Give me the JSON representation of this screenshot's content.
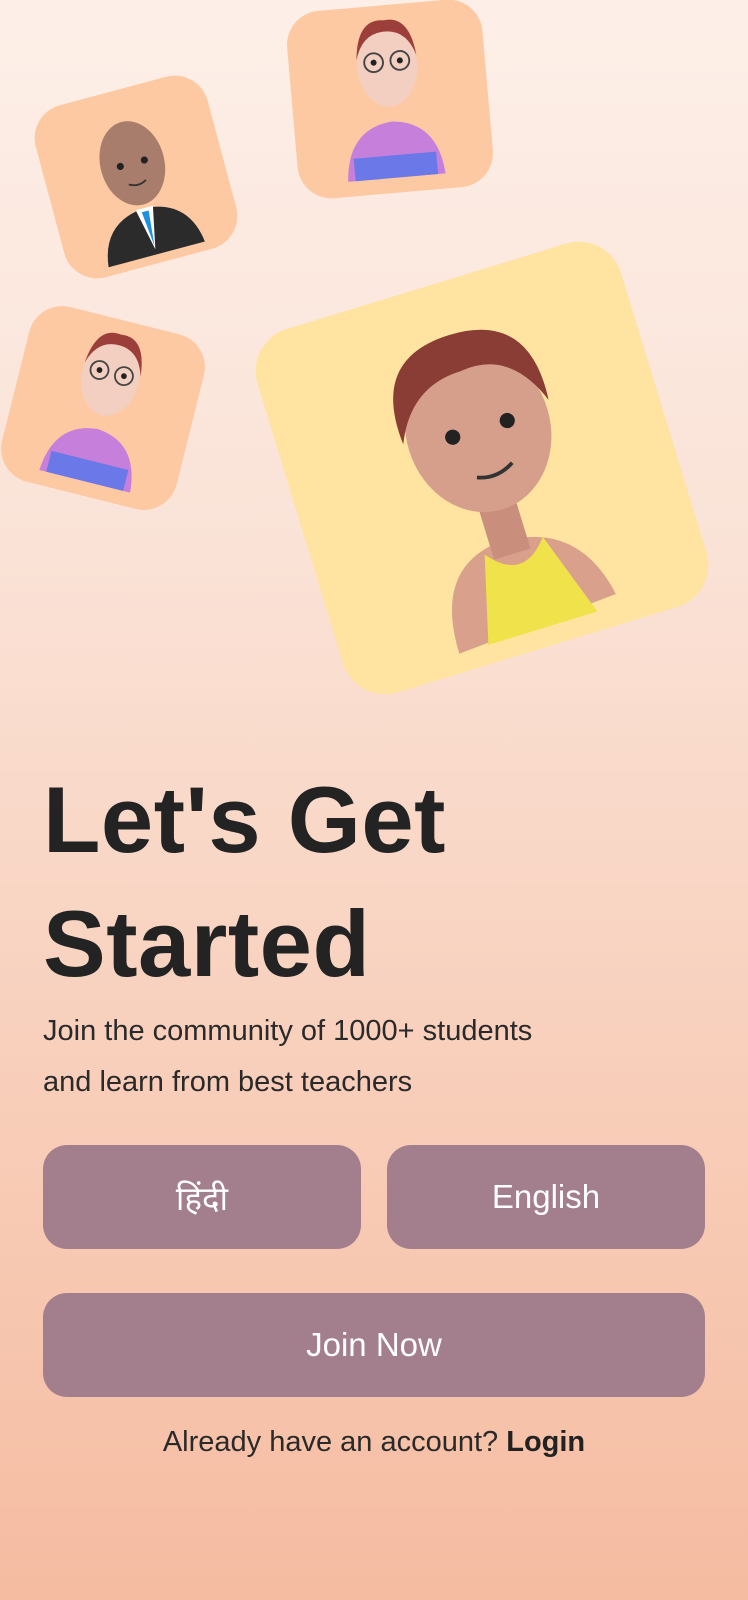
{
  "hero": {
    "title_line1": "Let's Get",
    "title_line2": "Started",
    "subtitle_line1": "Join the community of 1000+ students",
    "subtitle_line2": "and learn from best teachers"
  },
  "language": {
    "hindi_label": "हिंदी",
    "english_label": "English"
  },
  "join_label": "Join Now",
  "login": {
    "prompt": "Already have an account?",
    "link": "Login"
  },
  "colors": {
    "button": "#a37f8e",
    "card_peach": "#fdc9a3",
    "card_yellow": "#fee4a0"
  }
}
